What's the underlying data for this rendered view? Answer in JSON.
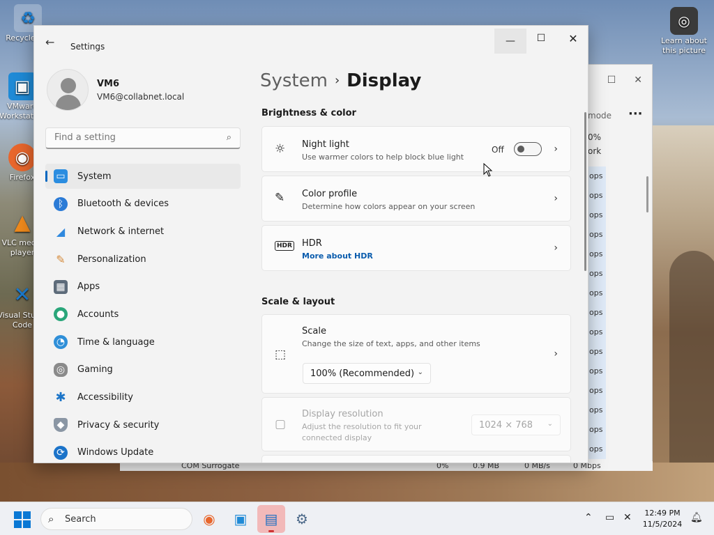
{
  "desktop": {
    "icons": [
      {
        "label": "Recycle Bin",
        "glyph": "♻"
      },
      {
        "label": "VMware Workstation",
        "glyph": "▣"
      },
      {
        "label": "Firefox",
        "glyph": "◉"
      },
      {
        "label": "VLC media player",
        "glyph": "▲"
      },
      {
        "label": "Visual Studio Code",
        "glyph": "✕"
      }
    ],
    "learn_about": "Learn about this picture"
  },
  "background_window": {
    "mode_label": "mode",
    "col_header_pct": "0%",
    "col_header_label": "ork",
    "row_value": "ops",
    "bottom_row": {
      "name": "COM Surrogate",
      "cpu": "0%",
      "mem": "0.9 MB",
      "disk": "0 MB/s",
      "net": "0 Mbps"
    }
  },
  "window": {
    "title": "Settings",
    "back_icon": "arrow-left-icon",
    "controls": {
      "minimize": "—",
      "maximize": "☐",
      "close": "✕"
    }
  },
  "profile": {
    "name": "VM6",
    "email": "VM6@collabnet.local"
  },
  "search": {
    "placeholder": "Find a setting"
  },
  "nav": {
    "items": [
      {
        "label": "System",
        "icon": "monitor-icon",
        "color": "#2b8de0",
        "active": true
      },
      {
        "label": "Bluetooth & devices",
        "icon": "bluetooth-icon",
        "color": "#2b7bd6"
      },
      {
        "label": "Network & internet",
        "icon": "wifi-icon",
        "color": "#2f89de"
      },
      {
        "label": "Personalization",
        "icon": "brush-icon",
        "color": "#d58a3b"
      },
      {
        "label": "Apps",
        "icon": "apps-icon",
        "color": "#5d6b7a"
      },
      {
        "label": "Accounts",
        "icon": "person-icon",
        "color": "#2aa67a"
      },
      {
        "label": "Time & language",
        "icon": "globe-clock-icon",
        "color": "#2f8fd8"
      },
      {
        "label": "Gaming",
        "icon": "gamepad-icon",
        "color": "#7b7b7b"
      },
      {
        "label": "Accessibility",
        "icon": "accessibility-icon",
        "color": "#1c75c8"
      },
      {
        "label": "Privacy & security",
        "icon": "shield-icon",
        "color": "#7a8796"
      },
      {
        "label": "Windows Update",
        "icon": "sync-icon",
        "color": "#1b73c9"
      }
    ]
  },
  "breadcrumb": {
    "parent": "System",
    "separator": "›",
    "current": "Display"
  },
  "sections": {
    "brightness": "Brightness & color",
    "scale_layout": "Scale & layout"
  },
  "cards": {
    "night_light": {
      "title": "Night light",
      "subtitle": "Use warmer colors to help block blue light",
      "state": "Off"
    },
    "color_profile": {
      "title": "Color profile",
      "subtitle": "Determine how colors appear on your screen"
    },
    "hdr": {
      "title": "HDR",
      "link": "More about HDR"
    },
    "scale": {
      "title": "Scale",
      "subtitle": "Change the size of text, apps, and other items",
      "value": "100% (Recommended)"
    },
    "resolution": {
      "title": "Display resolution",
      "subtitle": "Adjust the resolution to fit your connected display",
      "value": "1024 × 768"
    }
  },
  "taskbar": {
    "search_label": "Search",
    "time": "12:49 PM",
    "date": "11/5/2024"
  }
}
